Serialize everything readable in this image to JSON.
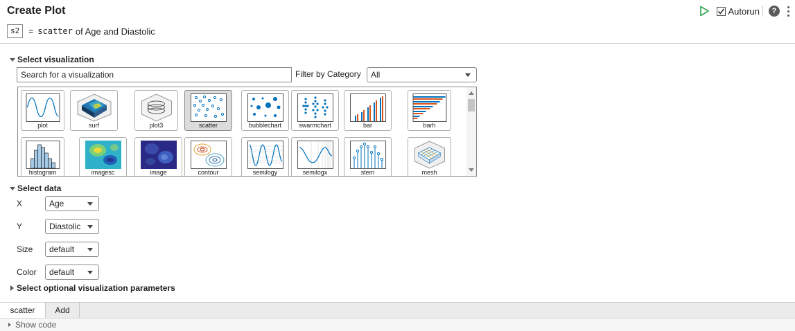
{
  "header": {
    "title": "Create Plot",
    "output_var": "s2",
    "equals": "=",
    "function_name": "scatter",
    "summary_rest": "of Age and Diastolic",
    "autorun_label": "Autorun",
    "autorun_checked": true,
    "help_symbol": "?"
  },
  "select_visualization": {
    "heading": "Select visualization",
    "search_value": "Search for a visualization",
    "filter_label": "Filter by Category",
    "filter_value": "All",
    "gallery": [
      {
        "label": "plot",
        "icon": "plot-icon",
        "selected": false
      },
      {
        "label": "surf",
        "icon": "surf-icon",
        "selected": false
      },
      {
        "label": "plot3",
        "icon": "plot3-icon",
        "selected": false
      },
      {
        "label": "scatter",
        "icon": "scatter-icon",
        "selected": true
      },
      {
        "label": "bubblechart",
        "icon": "bubblechart-icon",
        "selected": false
      },
      {
        "label": "swarmchart",
        "icon": "swarmchart-icon",
        "selected": false
      },
      {
        "label": "bar",
        "icon": "bar-icon",
        "selected": false
      },
      {
        "label": "barh",
        "icon": "barh-icon",
        "selected": false
      },
      {
        "label": "histogram",
        "icon": "histogram-icon",
        "selected": false
      },
      {
        "label": "imagesc",
        "icon": "imagesc-icon",
        "selected": false
      },
      {
        "label": "image",
        "icon": "image-icon",
        "selected": false
      },
      {
        "label": "contour",
        "icon": "contour-icon",
        "selected": false
      },
      {
        "label": "semilogy",
        "icon": "semilogy-icon",
        "selected": false
      },
      {
        "label": "semilogx",
        "icon": "semilogx-icon",
        "selected": false
      },
      {
        "label": "stem",
        "icon": "stem-icon",
        "selected": false
      },
      {
        "label": "mesh",
        "icon": "mesh-icon",
        "selected": false
      }
    ]
  },
  "select_data": {
    "heading": "Select data",
    "fields": [
      {
        "label": "X",
        "value": "Age"
      },
      {
        "label": "Y",
        "value": "Diastolic"
      },
      {
        "label": "Size",
        "value": "default"
      },
      {
        "label": "Color",
        "value": "default"
      }
    ]
  },
  "optional_params": {
    "heading": "Select optional visualization parameters"
  },
  "tabs": [
    {
      "label": "scatter",
      "active": true
    },
    {
      "label": "Add",
      "active": false
    }
  ],
  "footer": {
    "show_code_label": "Show code"
  },
  "colors": {
    "accent_blue": "#0072bd",
    "orange": "#d95319",
    "run_green": "#2ea44f",
    "selected_tile": "#dcdcdc"
  }
}
